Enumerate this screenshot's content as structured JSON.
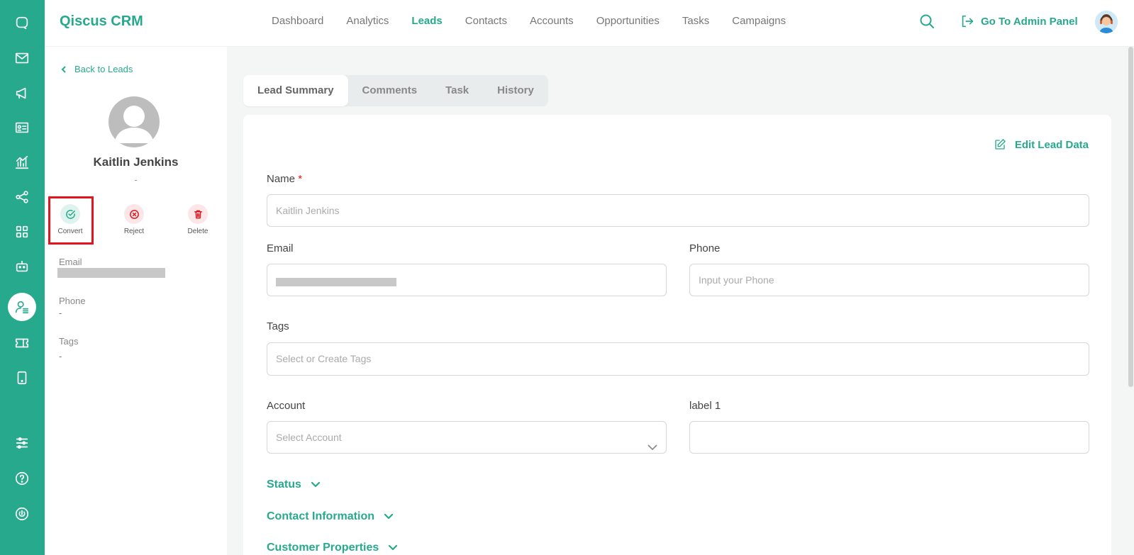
{
  "app": {
    "brand": "Qiscus CRM"
  },
  "nav": {
    "items": [
      "Dashboard",
      "Analytics",
      "Leads",
      "Contacts",
      "Accounts",
      "Opportunities",
      "Tasks",
      "Campaigns"
    ],
    "active": "Leads"
  },
  "header": {
    "admin_label": "Go To Admin Panel"
  },
  "rail": {
    "icons": [
      "chat-icon",
      "mail-icon",
      "megaphone-icon",
      "contact-card-icon",
      "chart-icon",
      "share-icon",
      "apps-icon",
      "bot-icon",
      "lead-icon",
      "ticket-icon",
      "mobile-icon",
      "settings-sliders-icon",
      "help-icon",
      "power-icon"
    ],
    "active": "lead-icon"
  },
  "profile": {
    "back_label": "Back to Leads",
    "name": "Kaitlin Jenkins",
    "subtitle": "-",
    "actions": {
      "convert": "Convert",
      "reject": "Reject",
      "delete": "Delete"
    },
    "email_label": "Email",
    "phone_label": "Phone",
    "phone_value": "-",
    "tags_label": "Tags",
    "tags_value": "-"
  },
  "tabs": [
    "Lead Summary",
    "Comments",
    "Task",
    "History"
  ],
  "form": {
    "edit_label": "Edit Lead Data",
    "name_label": "Name",
    "name_required": "*",
    "name_value": "Kaitlin Jenkins",
    "email_label": "Email",
    "phone_label": "Phone",
    "phone_placeholder": "Input your Phone",
    "tags_label": "Tags",
    "tags_placeholder": "Select or Create Tags",
    "account_label": "Account",
    "account_placeholder": "Select Account",
    "label1_label": "label 1",
    "sections": [
      "Status",
      "Contact Information",
      "Customer Properties"
    ]
  },
  "colors": {
    "accent": "#27a98d",
    "danger": "#e3141e"
  }
}
